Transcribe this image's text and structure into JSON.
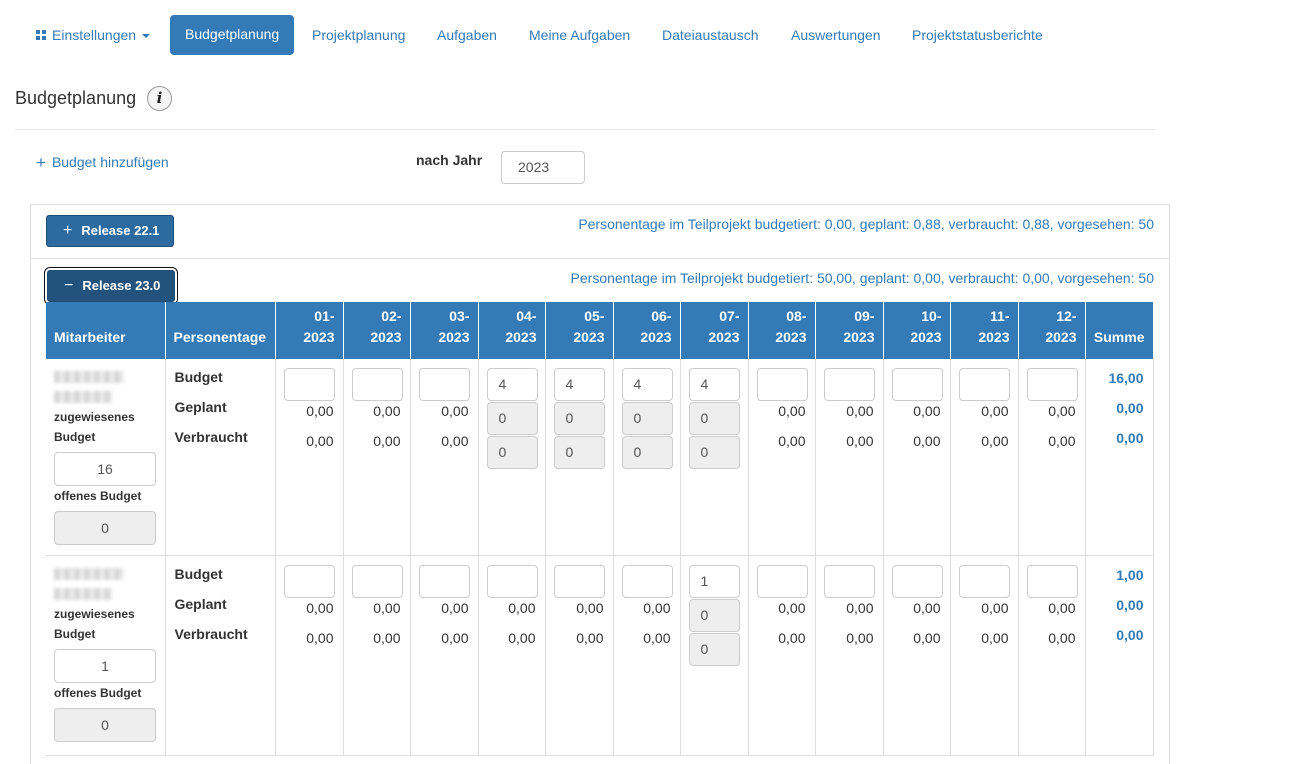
{
  "nav": {
    "settings": "Einstellungen",
    "items": [
      "Budgetplanung",
      "Projektplanung",
      "Aufgaben",
      "Meine Aufgaben",
      "Dateiaustausch",
      "Auswertungen",
      "Projektstatusberichte"
    ]
  },
  "page": {
    "title": "Budgetplanung",
    "info_icon": "i"
  },
  "toolbar": {
    "add_budget": "Budget hinzufügen",
    "year_label": "nach Jahr",
    "year_value": "2023"
  },
  "releases": [
    {
      "label": "Release 22.1",
      "symbol": "+",
      "summary": "Personentage im Teilprojekt budgetiert: 0,00, geplant: 0,88, verbraucht: 0,88, vorgesehen: 50"
    },
    {
      "label": "Release 23.0",
      "symbol": "−",
      "summary": "Personentage im Teilprojekt budgetiert: 50,00, geplant: 0,00, verbraucht: 0,00, vorgesehen: 50"
    }
  ],
  "table": {
    "headers": {
      "employee": "Mitarbeiter",
      "person_days": "Personentage",
      "months": [
        [
          "01-",
          "2023"
        ],
        [
          "02-",
          "2023"
        ],
        [
          "03-",
          "2023"
        ],
        [
          "04-",
          "2023"
        ],
        [
          "05-",
          "2023"
        ],
        [
          "06-",
          "2023"
        ],
        [
          "07-",
          "2023"
        ],
        [
          "08-",
          "2023"
        ],
        [
          "09-",
          "2023"
        ],
        [
          "10-",
          "2023"
        ],
        [
          "11-",
          "2023"
        ],
        [
          "12-",
          "2023"
        ]
      ],
      "sum": "Summe"
    },
    "row_labels": {
      "budget": "Budget",
      "planned": "Geplant",
      "used": "Verbraucht"
    },
    "employee_labels": {
      "assigned_line1": "zugewiesenes",
      "assigned_line2": "Budget",
      "open": "offenes Budget"
    },
    "rows": [
      {
        "assigned_budget": "16",
        "open_budget": "0",
        "budget": [
          "",
          "",
          "",
          "4",
          "4",
          "4",
          "4",
          "",
          "",
          "",
          "",
          ""
        ],
        "planned": [
          "0,00",
          "0,00",
          "0,00",
          "0",
          "0",
          "0",
          "0",
          "0,00",
          "0,00",
          "0,00",
          "0,00",
          "0,00"
        ],
        "used": [
          "0,00",
          "0,00",
          "0,00",
          "0",
          "0",
          "0",
          "0",
          "0,00",
          "0,00",
          "0,00",
          "0,00",
          "0,00"
        ],
        "editable": [
          false,
          false,
          false,
          true,
          true,
          true,
          true,
          false,
          false,
          false,
          false,
          false
        ],
        "sum": [
          "16,00",
          "0,00",
          "0,00"
        ]
      },
      {
        "assigned_budget": "1",
        "open_budget": "0",
        "budget": [
          "",
          "",
          "",
          "",
          "",
          "",
          "1",
          "",
          "",
          "",
          "",
          ""
        ],
        "planned": [
          "0,00",
          "0,00",
          "0,00",
          "0,00",
          "0,00",
          "0,00",
          "0",
          "0,00",
          "0,00",
          "0,00",
          "0,00",
          "0,00"
        ],
        "used": [
          "0,00",
          "0,00",
          "0,00",
          "0,00",
          "0,00",
          "0,00",
          "0",
          "0,00",
          "0,00",
          "0,00",
          "0,00",
          "0,00"
        ],
        "editable": [
          false,
          false,
          false,
          false,
          false,
          false,
          true,
          false,
          false,
          false,
          false,
          false
        ],
        "sum": [
          "1,00",
          "0,00",
          "0,00"
        ]
      }
    ]
  },
  "colors": {
    "accent": "#337ab7",
    "button_dark": "#2d6aa0",
    "border": "#dddddd",
    "readonly_bg": "#eeeeee"
  }
}
